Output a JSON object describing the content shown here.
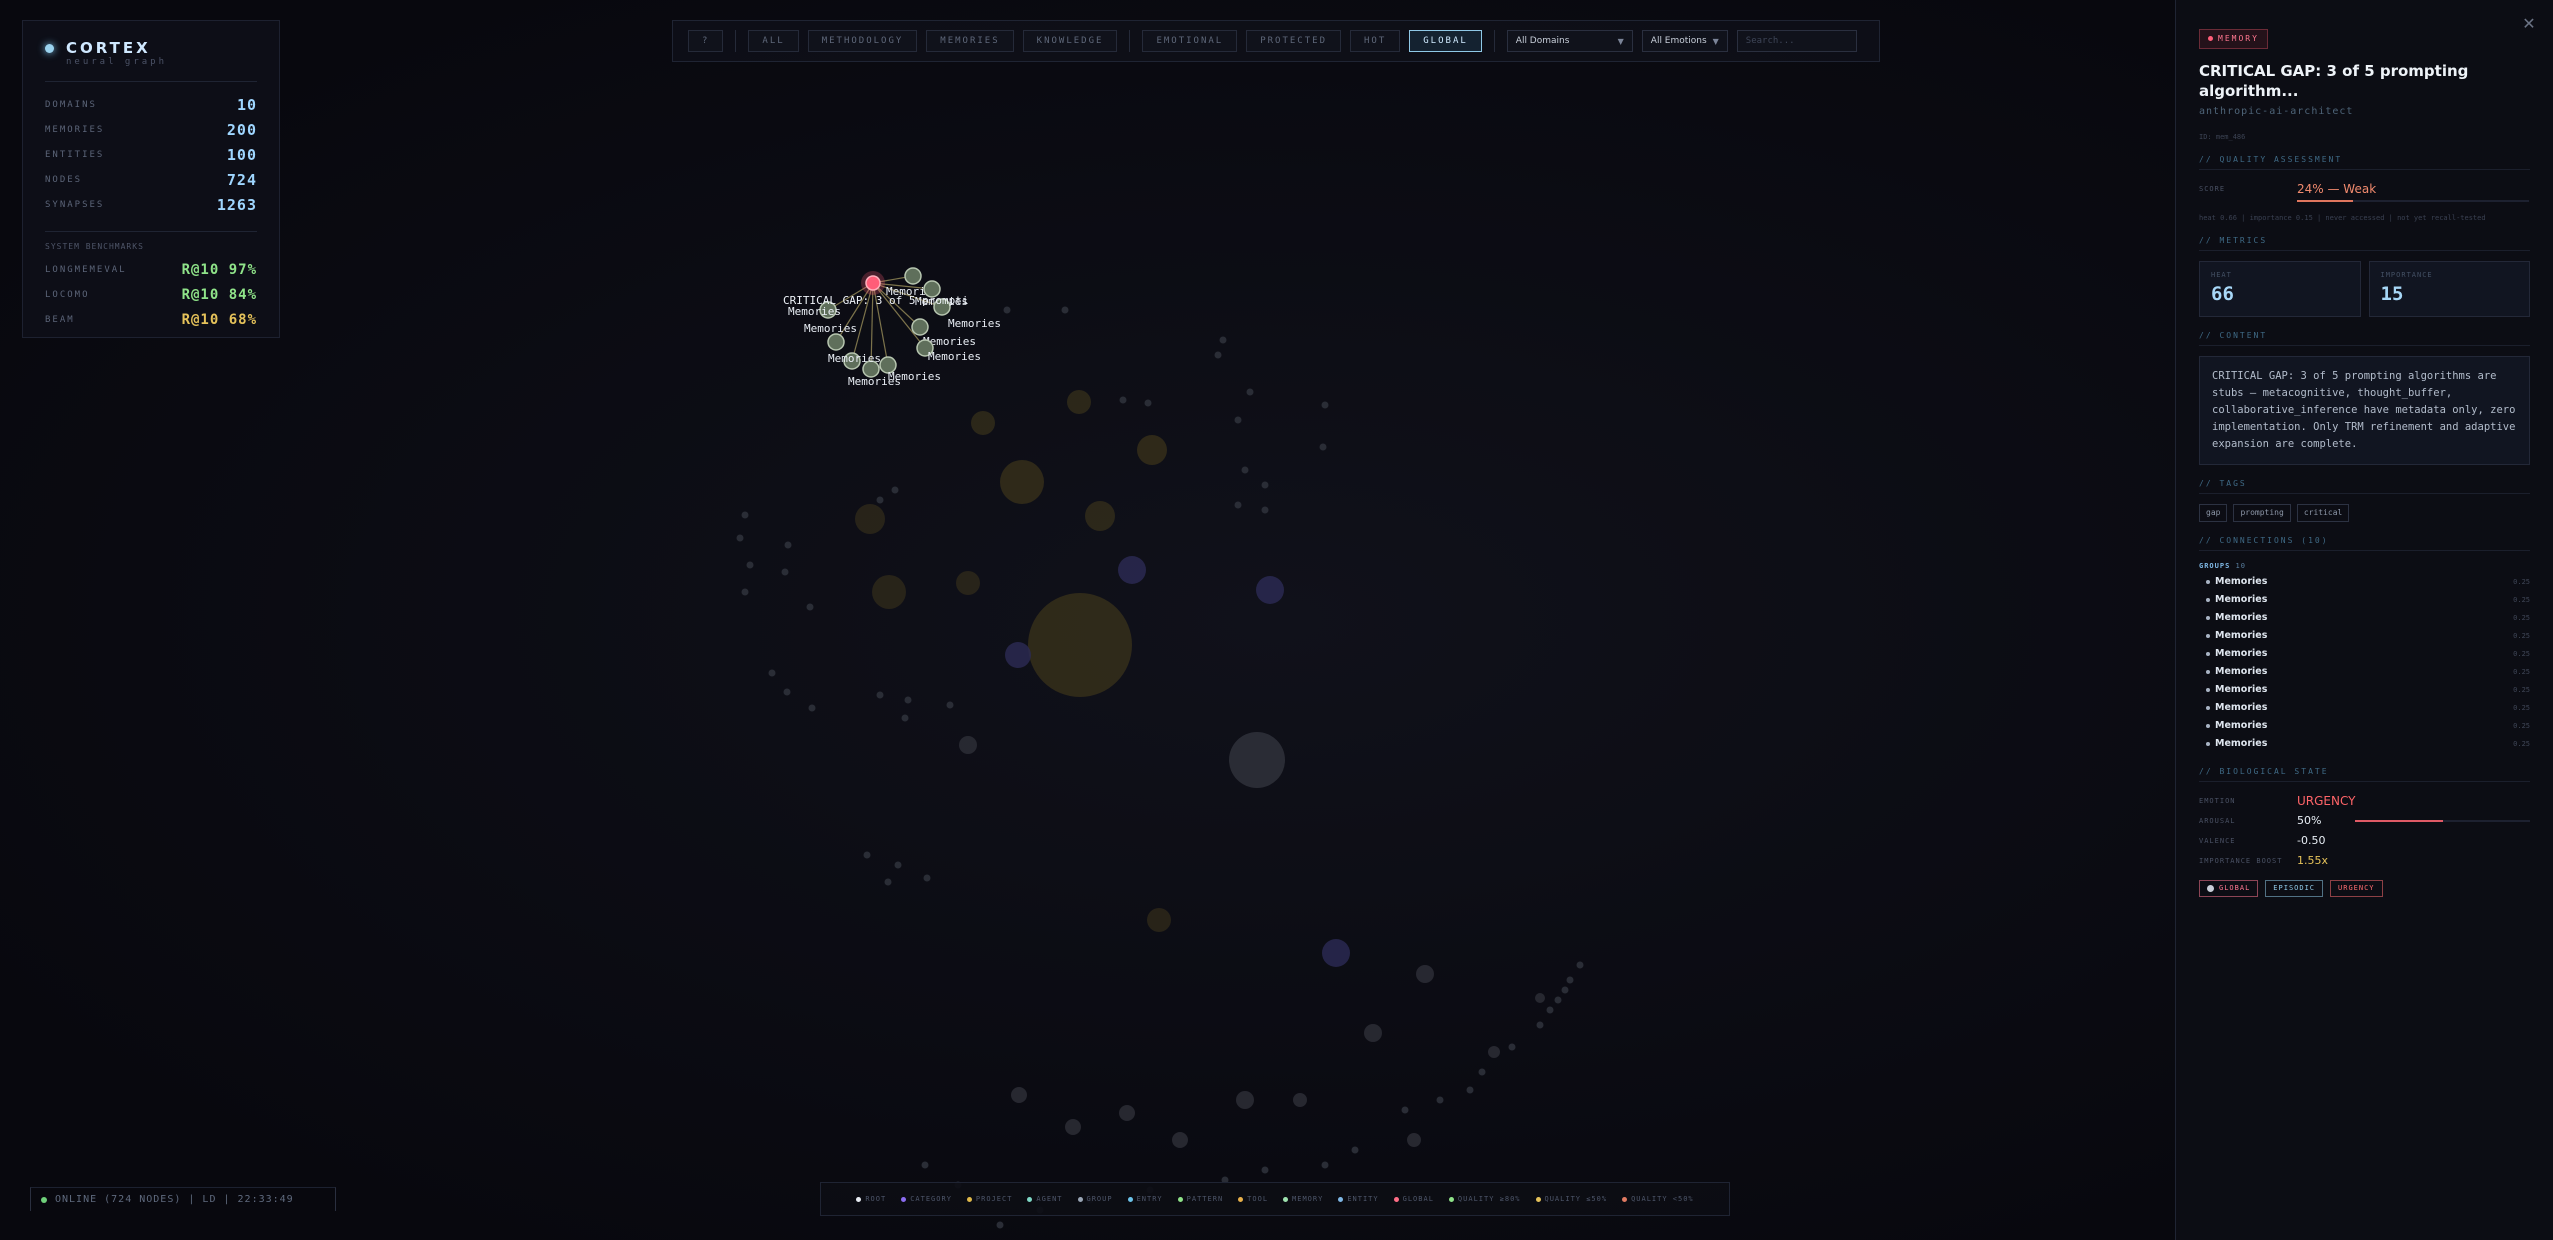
{
  "app": {
    "name": "CORTEX",
    "subtitle": "neural graph"
  },
  "stats": [
    {
      "label": "DOMAINS",
      "value": "10"
    },
    {
      "label": "MEMORIES",
      "value": "200"
    },
    {
      "label": "ENTITIES",
      "value": "100"
    },
    {
      "label": "NODES",
      "value": "724"
    },
    {
      "label": "SYNAPSES",
      "value": "1263"
    }
  ],
  "benchmarks": {
    "title": "SYSTEM BENCHMARKS",
    "items": [
      {
        "label": "LONGMEMEVAL",
        "value": "R@10 97%",
        "color": "#8fe389"
      },
      {
        "label": "LOCOMO",
        "value": "R@10 84%",
        "color": "#8fe389"
      },
      {
        "label": "BEAM",
        "value": "R@10 68%",
        "color": "#e5c25a"
      }
    ]
  },
  "toolbar": {
    "filters": [
      "?",
      "ALL",
      "METHODOLOGY",
      "MEMORIES",
      "KNOWLEDGE",
      "EMOTIONAL",
      "PROTECTED",
      "HOT",
      "GLOBAL"
    ],
    "active_filter": "GLOBAL",
    "domain_select": "All Domains",
    "emotion_select": "All Emotions",
    "search_placeholder": "Search..."
  },
  "status": {
    "text": "ONLINE (724 NODES) | LD | 22:33:49"
  },
  "legend": [
    {
      "label": "ROOT",
      "color": "#e8ecf3"
    },
    {
      "label": "CATEGORY",
      "color": "#8b6cf0"
    },
    {
      "label": "PROJECT",
      "color": "#e0b94a"
    },
    {
      "label": "AGENT",
      "color": "#7fd8c6"
    },
    {
      "label": "GROUP",
      "color": "#9aa6b6"
    },
    {
      "label": "ENTRY",
      "color": "#6cc3ea"
    },
    {
      "label": "PATTERN",
      "color": "#8fe389"
    },
    {
      "label": "TOOL",
      "color": "#e8b04a"
    },
    {
      "label": "MEMORY",
      "color": "#9fe3b0"
    },
    {
      "label": "ENTITY",
      "color": "#7fb8e6"
    },
    {
      "label": "GLOBAL",
      "color": "#ff6d86"
    },
    {
      "label": "QUALITY ≥80%",
      "color": "#8fe389"
    },
    {
      "label": "QUALITY ≤50%",
      "color": "#e5c25a"
    },
    {
      "label": "QUALITY <50%",
      "color": "#e07a62"
    }
  ],
  "graph": {
    "focus_label": "CRITICAL GAP: 3 of 5 prompti",
    "neighbor_label": "Memories",
    "neighbor_count": 10
  },
  "detail": {
    "close_icon": "✕",
    "badge": "MEMORY",
    "title": "CRITICAL GAP: 3 of 5 prompting algorithm...",
    "subtitle": "anthropic-ai-architect",
    "id": "ID: mem_486",
    "sections": {
      "quality": "// QUALITY ASSESSMENT",
      "metrics": "// METRICS",
      "content": "// CONTENT",
      "tags": "// TAGS",
      "connections": "// CONNECTIONS (10)",
      "bio": "// BIOLOGICAL STATE"
    },
    "quality": {
      "label": "SCORE",
      "value": "24% — Weak",
      "fraction": 0.24,
      "note": "heat 0.66 | importance 0.15 | never accessed | not yet recall-tested"
    },
    "metrics": [
      {
        "label": "HEAT",
        "value": "66"
      },
      {
        "label": "IMPORTANCE",
        "value": "15"
      }
    ],
    "content": "CRITICAL GAP: 3 of 5 prompting algorithms are stubs — metacognitive, thought_buffer, collaborative_inference have metadata only, zero implementation. Only TRM refinement and adaptive expansion are complete.",
    "tags": [
      "gap",
      "prompting",
      "critical"
    ],
    "groups_label": "GROUPS",
    "groups_count": "10",
    "connections": [
      {
        "name": "Memories",
        "weight": "0.25"
      },
      {
        "name": "Memories",
        "weight": "0.25"
      },
      {
        "name": "Memories",
        "weight": "0.25"
      },
      {
        "name": "Memories",
        "weight": "0.25"
      },
      {
        "name": "Memories",
        "weight": "0.25"
      },
      {
        "name": "Memories",
        "weight": "0.25"
      },
      {
        "name": "Memories",
        "weight": "0.25"
      },
      {
        "name": "Memories",
        "weight": "0.25"
      },
      {
        "name": "Memories",
        "weight": "0.25"
      },
      {
        "name": "Memories",
        "weight": "0.25"
      }
    ],
    "bio": {
      "emotion_label": "EMOTION",
      "emotion_value": "URGENCY",
      "arousal_label": "AROUSAL",
      "arousal_value": "50%",
      "arousal_fraction": 0.5,
      "valence_label": "VALENCE",
      "valence_value": "-0.50",
      "boost_label": "IMPORTANCE BOOST",
      "boost_value": "1.55x"
    },
    "chips": [
      {
        "label": "GLOBAL",
        "color": "#ff7790"
      },
      {
        "label": "EPISODIC",
        "color": "#8fc8e6"
      },
      {
        "label": "URGENCY",
        "color": "#ff6d70"
      }
    ]
  }
}
